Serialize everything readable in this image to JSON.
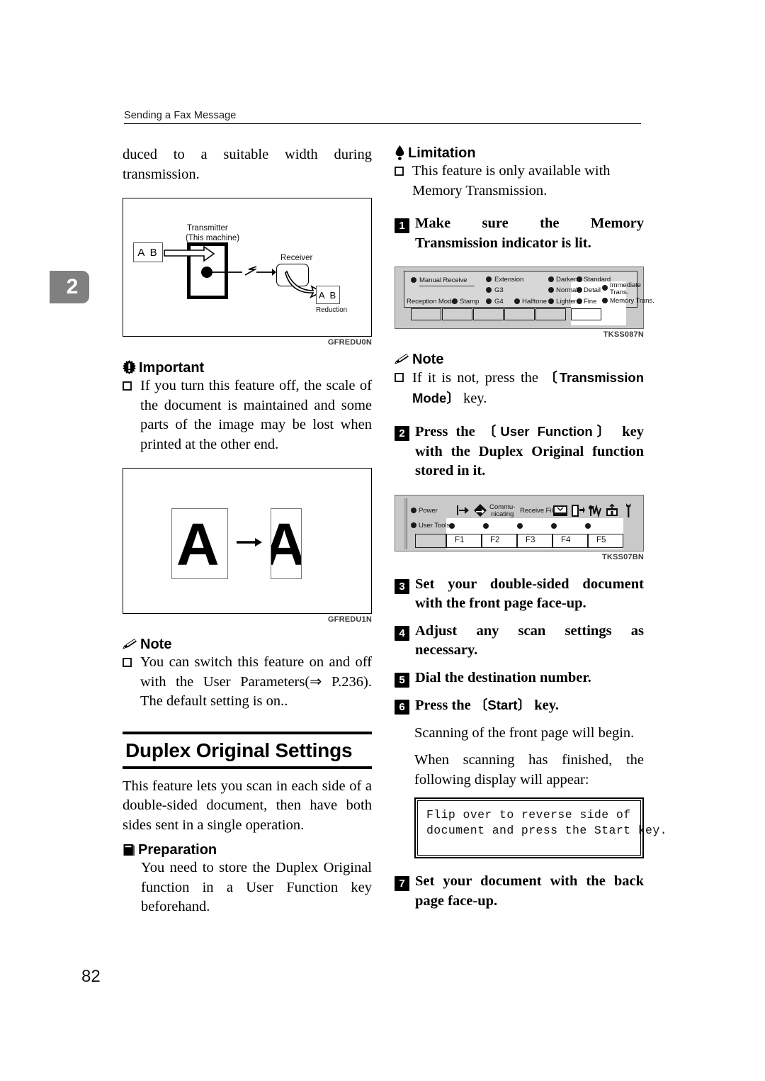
{
  "header": {
    "running_title": "Sending a Fax Message"
  },
  "chapter_tab": {
    "number": "2"
  },
  "page_number": "82",
  "left_column": {
    "continued_paragraph": "duced to a suitable width during transmission.",
    "figure_transmit": {
      "label_transmitter_line1": "Transmitter",
      "label_transmitter_line2": "(This machine)",
      "label_receiver": "Receiver",
      "label_source_doc": "A B",
      "label_result_doc": "A B",
      "label_reduction": "Reduction",
      "figure_code": "GFREDU0N"
    },
    "important": {
      "icon": "important-icon",
      "heading": "Important",
      "bullet": "If you turn this feature off, the scale of the document is maintained and some parts of the image may be lost when printed at the other end."
    },
    "figure_reduce": {
      "letter_large": "A",
      "letter_small": "A",
      "arrow": "→",
      "figure_code": "GFREDU1N"
    },
    "note": {
      "icon": "note-pencil-icon",
      "heading": "Note",
      "bullet": "You can switch this feature on and off with the User Parameters(⇒ P.236). The default setting is on.."
    },
    "section": {
      "title": "Duplex Original Settings",
      "intro": "This feature lets you scan in each side of a double-sided document, then have both sides sent in a single operation."
    },
    "preparation": {
      "icon": "preparation-book-icon",
      "heading": "Preparation",
      "body": "You need to store the Duplex Original function in a User Function key beforehand."
    }
  },
  "right_column": {
    "limitation": {
      "icon": "limitation-icon",
      "heading": "Limitation",
      "bullet": "This feature is only available with Memory Transmission."
    },
    "step1": {
      "number": "1",
      "text": "Make sure the Memory Transmission indicator is lit."
    },
    "panel_indicators": {
      "figure_code": "TKSS087N",
      "labels": [
        "Manual Receive",
        "Reception Mode",
        "Stamp",
        "Extension",
        "G3",
        "G4",
        "Halftone",
        "Darken",
        "Normal",
        "Lighten",
        "Standard",
        "Detail",
        "Fine",
        "Immediate",
        "Trans.",
        "Memory Trans."
      ]
    },
    "note": {
      "icon": "note-pencil-icon",
      "heading": "Note",
      "bullet_pre": "If it is not, press the ",
      "bullet_key": "Transmission Mode",
      "bullet_post": " key."
    },
    "step2": {
      "number": "2",
      "pre": "Press the ",
      "key": "User Function",
      "post": " key with the Duplex Original function stored in it."
    },
    "panel_function_keys": {
      "figure_code": "TKSS07BN",
      "label_power": "Power",
      "label_user_tools": "User Tools",
      "label_communicating_line1": "Commu-",
      "label_communicating_line2": "nicating",
      "label_receive_file": "Receive File",
      "function_keys": [
        "F1",
        "F2",
        "F3",
        "F4",
        "F5"
      ],
      "icons": [
        "dial-in-icon",
        "communicating-icon",
        "receive-file-icon",
        "memory-file-icon",
        "error-icon",
        "add-toner-icon",
        "service-call-icon"
      ]
    },
    "step3": {
      "number": "3",
      "text": "Set your double-sided document with the front page face-up."
    },
    "step4": {
      "number": "4",
      "text": "Adjust any scan settings as necessary."
    },
    "step5": {
      "number": "5",
      "text": "Dial the destination number."
    },
    "step6": {
      "number": "6",
      "pre": "Press the ",
      "key": "Start",
      "post": " key."
    },
    "after_step6": {
      "paragraph1": "Scanning of the front page will begin.",
      "paragraph2": "When scanning has finished, the following display will appear:"
    },
    "lcd_display": {
      "line1": "Flip over to reverse side of",
      "line2": "document and press the Start key."
    },
    "step7": {
      "number": "7",
      "text": "Set your document with the back page face-up."
    }
  },
  "colors": {
    "tab_gray": "#808080",
    "panel_gray": "#c9c9c9",
    "panel_inner_gray": "#d7d7d7",
    "key_gray": "#cfcfcf",
    "ink": "#000000"
  }
}
